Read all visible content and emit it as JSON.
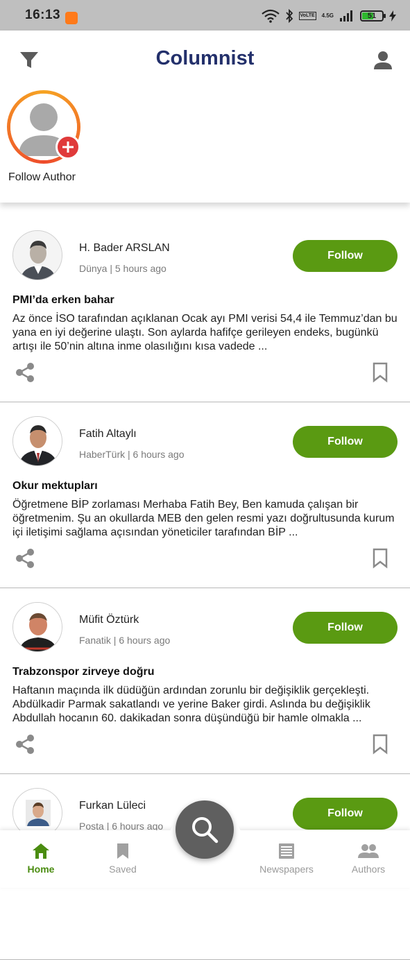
{
  "status_bar": {
    "time": "16:13",
    "network": "4.5G",
    "volte": "VoLTE",
    "battery": "51",
    "icons": [
      "app-notification-icon",
      "wifi-icon",
      "bluetooth-icon",
      "signal-icon",
      "charging-icon"
    ]
  },
  "header": {
    "title": "Columnist",
    "left_icon": "filter-icon",
    "right_icon": "profile-icon",
    "follow_author_label": "Follow Author"
  },
  "colors": {
    "title": "#23306b",
    "follow_button": "#5a9a12",
    "active_nav": "#4a8c10",
    "inactive_nav": "#9a9a9a",
    "fab": "#5f5f5f",
    "add_badge": "#e03a3a"
  },
  "feed": [
    {
      "author": "H. Bader ARSLAN",
      "meta": "Dünya | 5 hours ago",
      "follow_label": "Follow",
      "title": "PMI’da erken bahar",
      "excerpt": "Az önce İSO tarafından açıklanan Ocak ayı PMI verisi 54,4 ile Temmuz’dan bu yana en iyi değerine ulaştı. Son aylarda hafifçe gerileyen endeks, bugünkü artışı ile 50’nin altına inme olasılığını kısa vadede ..."
    },
    {
      "author": "Fatih Altaylı",
      "meta": "HaberTürk | 6 hours ago",
      "follow_label": "Follow",
      "title": "Okur mektupları",
      "excerpt": "Öğretmene BİP zorlaması Merhaba Fatih Bey, Ben kamuda çalışan bir öğretmenim. Şu an okullarda MEB den gelen resmi yazı doğrultusunda kurum içi iletişimi sağlama açısından yöneticiler tarafından BİP ..."
    },
    {
      "author": "Müfit Öztürk",
      "meta": "Fanatik | 6 hours ago",
      "follow_label": "Follow",
      "title": "Trabzonspor zirveye doğru",
      "excerpt": "Haftanın maçında ilk düdüğün ardından zorunlu bir değişiklik gerçekleşti. Abdülkadir Parmak sakatlandı ve yerine Baker girdi. Aslında bu değişiklik Abdullah hocanın 60. dakikadan sonra düşündüğü bir hamle olmakla ..."
    },
    {
      "author": "Furkan Lüleci",
      "meta": "Posta | 6 hours ago",
      "follow_label": "Follow",
      "title": "",
      "excerpt": ""
    }
  ],
  "bottom_nav": [
    {
      "label": "Home",
      "icon": "home-icon",
      "active": true
    },
    {
      "label": "Saved",
      "icon": "bookmark-icon",
      "active": false
    },
    {
      "label": "Newspapers",
      "icon": "newspaper-icon",
      "active": false
    },
    {
      "label": "Authors",
      "icon": "people-icon",
      "active": false
    }
  ],
  "fab_icon": "search-icon"
}
